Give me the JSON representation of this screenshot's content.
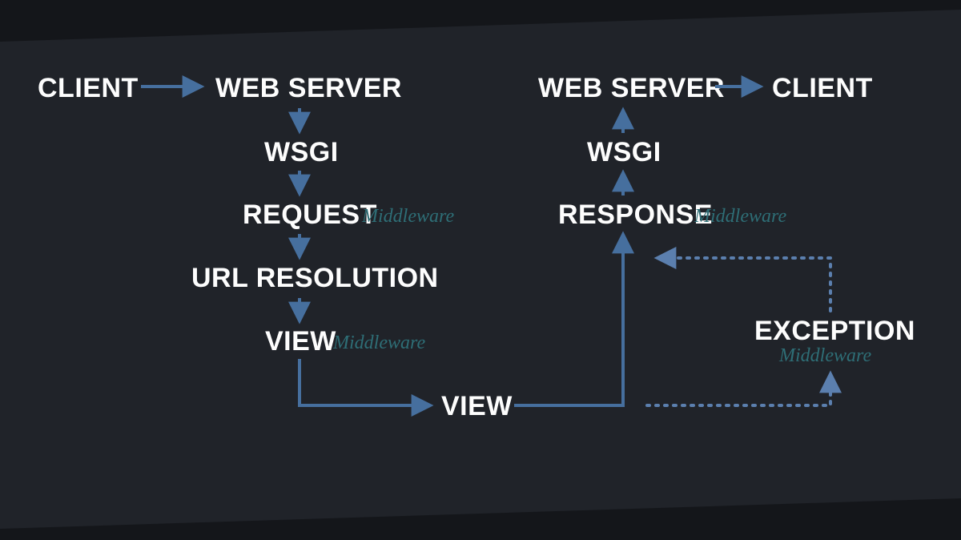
{
  "colors": {
    "bg": "#202329",
    "wedge": "#15171b",
    "text": "#fdfdfd",
    "arrow": "#466f9e",
    "accent": "#2e6e76"
  },
  "nodes": {
    "client_left": "CLIENT",
    "web_server_left": "WEB SERVER",
    "wsgi_left": "WSGI",
    "request": "REQUEST",
    "url_resolution": "URL RESOLUTION",
    "view_mw": "VIEW",
    "view_center": "VIEW",
    "response": "RESPONSE",
    "wsgi_right": "WSGI",
    "web_server_right": "WEB SERVER",
    "client_right": "CLIENT",
    "exception": "EXCEPTION"
  },
  "middleware": {
    "request": "Middleware",
    "view": "Middleware",
    "response": "Middleware",
    "exception": "Middleware"
  }
}
